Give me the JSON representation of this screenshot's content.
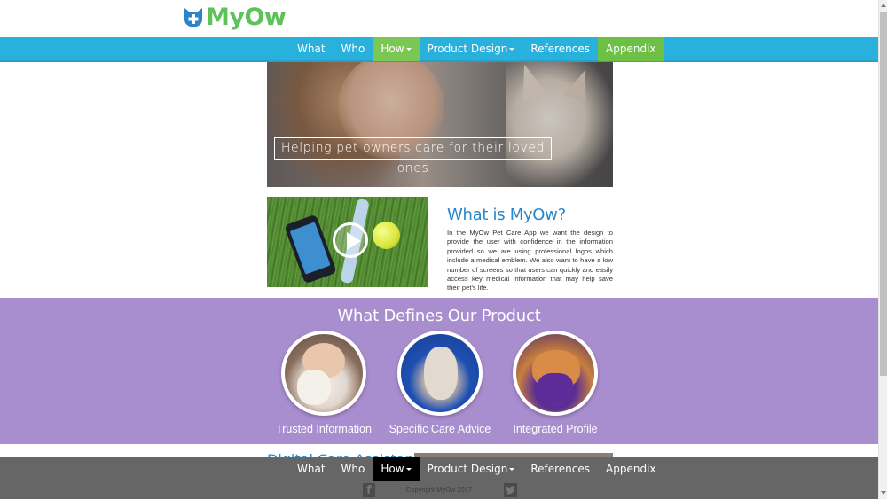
{
  "brand": {
    "name": "MyOw",
    "logo_icon": "cat-cross-shield-icon",
    "color": "#5dc25a",
    "icon_color": "#2a86c8"
  },
  "nav": {
    "items": [
      {
        "label": "What",
        "dropdown": false
      },
      {
        "label": "Who",
        "dropdown": false
      },
      {
        "label": "How",
        "dropdown": true,
        "active": true
      },
      {
        "label": "Product Design",
        "dropdown": true
      },
      {
        "label": "References",
        "dropdown": false
      },
      {
        "label": "Appendix",
        "dropdown": false,
        "highlighted": true
      }
    ],
    "bar_color": "#29b1de",
    "active_color": "#7ac754"
  },
  "hero": {
    "caption": "Helping pet owners care for their loved ones"
  },
  "video": {
    "icon": "play-icon"
  },
  "what": {
    "title": "What is MyOw?",
    "body": "In the MyOw Pet Care App we want the design to provide the user with confidence in the information provided so we are using professional logos which include a medical emblem. We also want to have a low number of screens so that users can quickly and easily access key medical information that may help save their pet's life."
  },
  "product": {
    "title": "What Defines Our Product",
    "background": "#a98ecf",
    "features": [
      {
        "label": "Trusted Information"
      },
      {
        "label": "Specific Care Advice"
      },
      {
        "label": "Integrated Profile"
      }
    ]
  },
  "next_section": {
    "title": "Digital Care Assistant"
  },
  "footer": {
    "nav": [
      "What",
      "Who",
      "How",
      "Product Design",
      "References",
      "Appendix"
    ],
    "copyright": "Copyright MyOw 2017",
    "facebook_icon": "facebook-icon",
    "twitter_icon": "twitter-icon",
    "background": "#666666"
  }
}
